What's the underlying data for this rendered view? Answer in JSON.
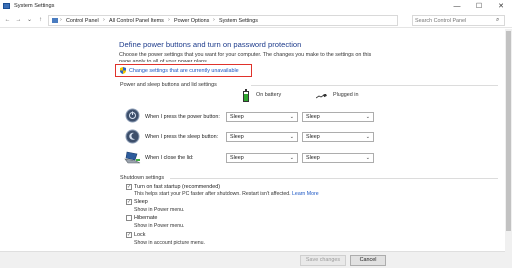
{
  "window": {
    "title": "System Settings",
    "minimize_glyph": "—",
    "maximize_glyph": "☐",
    "close_glyph": "✕"
  },
  "nav": {
    "back_glyph": "←",
    "forward_glyph": "→",
    "dropdown_glyph": "⌄",
    "up_glyph": "↑",
    "breadcrumbs": [
      "Control Panel",
      "All Control Panel Items",
      "Power Options",
      "System Settings"
    ],
    "separator": "›",
    "refresh_glyph": "↻",
    "search_placeholder": "Search Control Panel",
    "search_glyph": "⌕"
  },
  "page": {
    "heading": "Define power buttons and turn on password protection",
    "description": "Choose the power settings that you want for your computer. The changes you make to the settings on this page apply to all of your power plans.",
    "change_link": "Change settings that are currently unavailable"
  },
  "power_section": {
    "title": "Power and sleep buttons and lid settings",
    "col_battery": "On battery",
    "col_plugged": "Plugged in",
    "rows": [
      {
        "label": "When I press the power button:",
        "battery": "Sleep",
        "plugged": "Sleep"
      },
      {
        "label": "When I press the sleep button:",
        "battery": "Sleep",
        "plugged": "Sleep"
      },
      {
        "label": "When I close the lid:",
        "battery": "Sleep",
        "plugged": "Sleep"
      }
    ],
    "dropdown_glyph": "⌄"
  },
  "shutdown_section": {
    "title": "Shutdown settings",
    "items": [
      {
        "label": "Turn on fast startup (recommended)",
        "help": "This helps start your PC faster after shutdown. Restart isn't affected.",
        "checked": true,
        "mark": "✓"
      },
      {
        "label": "Sleep",
        "help": "Show in Power menu.",
        "checked": true,
        "mark": "✓"
      },
      {
        "label": "Hibernate",
        "help": "Show in Power menu.",
        "checked": false,
        "mark": ""
      },
      {
        "label": "Lock",
        "help": "Show in account picture menu.",
        "checked": true,
        "mark": "✓"
      }
    ],
    "learn_more": "Learn More"
  },
  "footer": {
    "save_label": "Save changes",
    "cancel_label": "Cancel"
  },
  "colors": {
    "heading": "#1e3c8c",
    "link": "#1a56c4",
    "highlight_box": "#e0322b"
  }
}
